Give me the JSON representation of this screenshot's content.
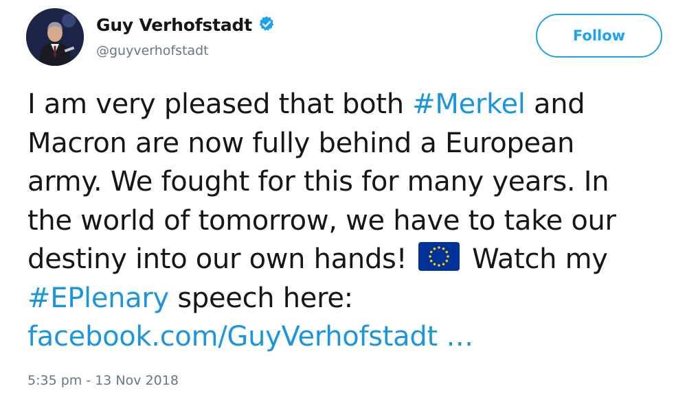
{
  "author": {
    "display_name": "Guy Verhofstadt",
    "handle": "@guyverhofstadt",
    "avatar_icon": "avatar",
    "verified_icon": "verified-badge-icon"
  },
  "follow_button": {
    "label": "Follow"
  },
  "tweet": {
    "line1_a": "I am very pleased that both ",
    "hashtag_merkel": "#Merkel",
    "line1_b": " and",
    "line2": "Macron are now fully behind a European",
    "line3": "army. We fought for this for many years. In",
    "line4": "the world of tomorrow, we have to take our",
    "line5_a": "destiny into our own hands! ",
    "emoji": "eu-flag-emoji",
    "line5_b": " Watch my",
    "hashtag_eplenary": "#EPlenary",
    "line6_b": " speech here:",
    "link": "facebook.com/GuyVerhofstadt …"
  },
  "timestamp": "5:35 pm - 13 Nov 2018",
  "colors": {
    "accent": "#1da1f2",
    "link": "#1b95e0",
    "text": "#14171a",
    "secondary": "#657786",
    "eu_blue": "#003399",
    "eu_gold": "#ffcc00"
  }
}
